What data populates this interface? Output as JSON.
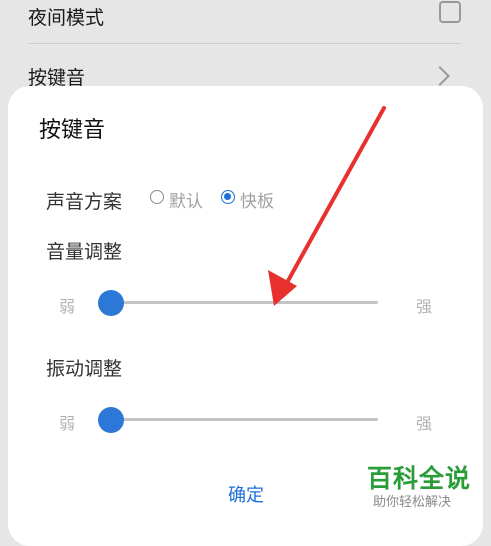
{
  "background": {
    "night_mode_label": "夜间模式",
    "key_sound_label": "按键音"
  },
  "dialog": {
    "title": "按键音",
    "sound_scheme": {
      "label": "声音方案",
      "options": [
        {
          "label": "默认",
          "selected": false
        },
        {
          "label": "快板",
          "selected": true
        }
      ]
    },
    "volume": {
      "label": "音量调整",
      "min_label": "弱",
      "max_label": "强",
      "value_fraction": 0.0
    },
    "vibration": {
      "label": "振动调整",
      "min_label": "弱",
      "max_label": "强",
      "value_fraction": 0.0
    },
    "ok_label": "确定"
  },
  "watermark": {
    "title": "百科全说",
    "subtitle": "助你轻松解决"
  },
  "colors": {
    "accent": "#1e6fd9",
    "annotation_arrow": "#e8312f",
    "watermark_green": "#2a9d39"
  }
}
